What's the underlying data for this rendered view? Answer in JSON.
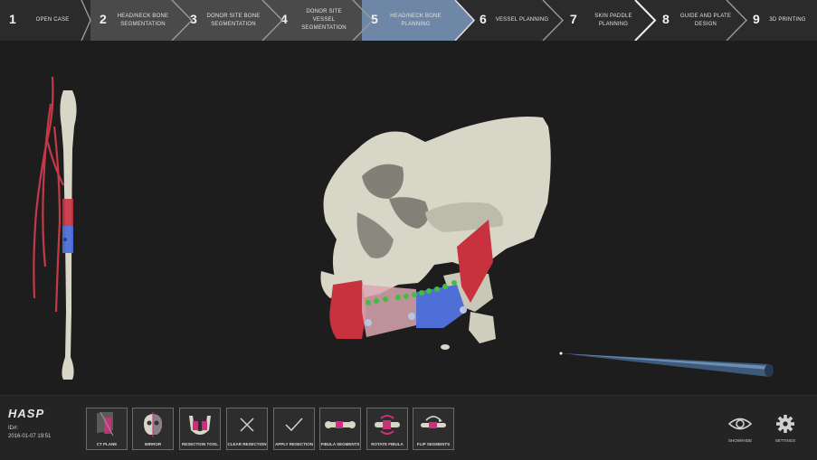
{
  "steps": [
    {
      "num": "1",
      "label": "OPEN CASE"
    },
    {
      "num": "2",
      "label": "HEAD/NECK BONE SEGMENTATION"
    },
    {
      "num": "3",
      "label": "DONOR SITE BONE SEGMENTATION"
    },
    {
      "num": "4",
      "label": "DONOR SITE VESSEL SEGMENTATION"
    },
    {
      "num": "5",
      "label": "HEAD/NECK BONE PLANNING"
    },
    {
      "num": "6",
      "label": "VESSEL PLANNING"
    },
    {
      "num": "7",
      "label": "SKIN PADDLE PLANNING"
    },
    {
      "num": "8",
      "label": "GUIDE AND PLATE DESIGN"
    },
    {
      "num": "9",
      "label": "3D PRINTING"
    }
  ],
  "active_step": 5,
  "footer": {
    "logo": "HASP",
    "id_label": "ID#:",
    "date": "2016-01-07 19:51"
  },
  "tools": [
    {
      "label": "CT PLANE",
      "icon": "ct-plane-icon"
    },
    {
      "label": "MIRROR",
      "icon": "mirror-icon"
    },
    {
      "label": "RESECTION TOOL",
      "icon": "resection-tool-icon"
    },
    {
      "label": "CLEAR RESECTION",
      "icon": "clear-x-icon"
    },
    {
      "label": "APPLY RESECTION",
      "icon": "checkmark-icon"
    },
    {
      "label": "FIBULA SEGMENTS",
      "icon": "fibula-segments-icon"
    },
    {
      "label": "ROTATE FIBULA",
      "icon": "rotate-fibula-icon"
    },
    {
      "label": "FLIP SEGMENTS",
      "icon": "flip-segments-icon"
    }
  ],
  "right_buttons": {
    "show_hide": "SHOW/HIDE",
    "settings": "SETTINGS"
  },
  "colors": {
    "active_step": "#6f87a6",
    "done_step": "#4a4a4a",
    "bone": "#d8d6c6",
    "resection_red": "#c8323f",
    "segment_blue": "#4f6fd6",
    "marker_green": "#3fbf3f",
    "vessel_red": "#c43a48"
  }
}
